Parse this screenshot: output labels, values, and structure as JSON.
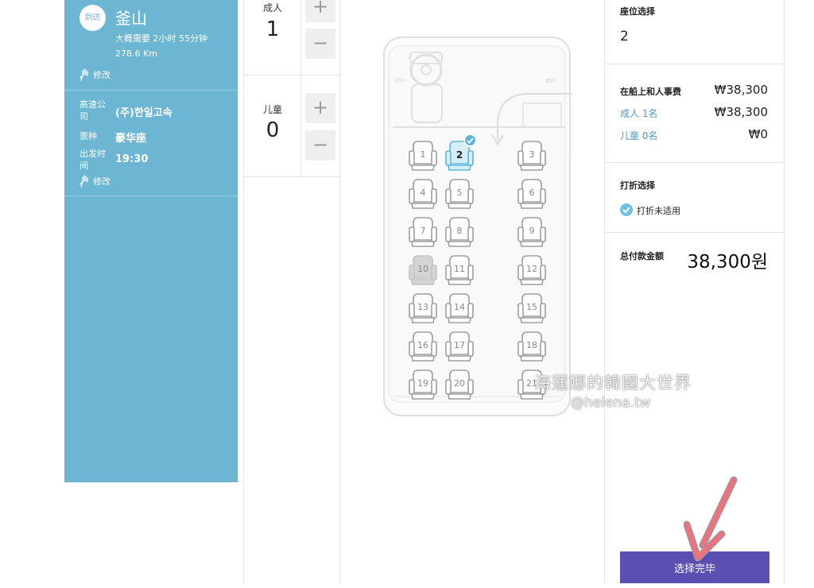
{
  "trip": {
    "arrive_badge": "到达",
    "destination": "釜山",
    "duration": "大概需要 2小时 55分钟",
    "distance": "278.6 Km",
    "edit_label": "修改",
    "company_label": "高速公司",
    "company_value": "(주)한일고속",
    "ticket_label": "票种",
    "ticket_value": "豪华座",
    "depart_label": "出发时间",
    "depart_value": "19:30",
    "edit_label_2": "修改"
  },
  "passengers": {
    "adult_label": "成人",
    "adult_count": "1",
    "child_label": "儿童",
    "child_count": "0",
    "plus": "+",
    "minus": "−"
  },
  "seatmap": {
    "selected_seat": "2",
    "taken_seats": [
      "10"
    ],
    "rows": [
      [
        "1",
        "2",
        "3"
      ],
      [
        "4",
        "5",
        "6"
      ],
      [
        "7",
        "8",
        "9"
      ],
      [
        "10",
        "11",
        "12"
      ],
      [
        "13",
        "14",
        "15"
      ],
      [
        "16",
        "17",
        "18"
      ],
      [
        "19",
        "20",
        "21"
      ]
    ],
    "driver_label": "운전석",
    "door_label": "출입구"
  },
  "summary": {
    "seat_heading": "座位选择",
    "seat_value": "2",
    "fare_heading": "在船上和人事费",
    "fare_total": "₩38,300",
    "adult_line": "成人 1名",
    "adult_amount": "₩38,300",
    "child_line": "儿童 0名",
    "child_amount": "₩0",
    "discount_heading": "打折选择",
    "discount_option": "打折未适用",
    "total_heading": "总付款金额",
    "total_value": "38,300원",
    "confirm_label": "选择完毕"
  },
  "watermark": {
    "line1": "海蓮娜的韓國大世界",
    "line2": "@helena.tw"
  },
  "colors": {
    "panel_blue": "#6cb5d3",
    "confirm_purple": "#5b4fb3",
    "selected_seat": "#5bb8dd",
    "arrow": "#f0707e"
  }
}
